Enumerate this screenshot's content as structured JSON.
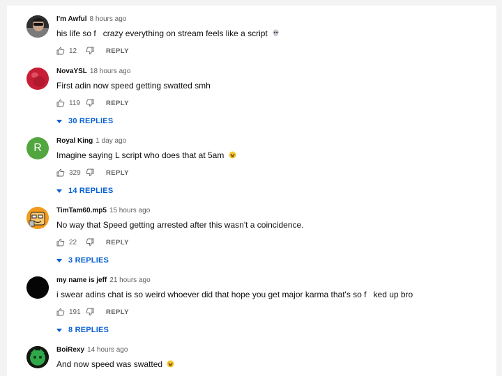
{
  "comments": [
    {
      "author": "I'm Awful",
      "time": "8 hours ago",
      "text_a": "his life so f",
      "text_b": "crazy everything on stream feels like a script",
      "emoji": "skull",
      "likes": "12",
      "reply_label": "REPLY",
      "avatar_icon": "man-with-sunglasses-avatar"
    },
    {
      "author": "NovaYSL",
      "time": "18 hours ago",
      "text": "First adin now speed getting swatted smh",
      "likes": "119",
      "reply_label": "REPLY",
      "replies_label": "30 REPLIES",
      "avatar_icon": "red-apple-avatar"
    },
    {
      "author": "Royal King",
      "time": "1 day ago",
      "text": "Imagine saying L script who does that at 5am",
      "emoji": "laughing-face",
      "likes": "329",
      "reply_label": "REPLY",
      "replies_label": "14 REPLIES",
      "avatar_letter": "R",
      "avatar_color": "#52a63f"
    },
    {
      "author": "TimTam60.mp5",
      "time": "15 hours ago",
      "text": "No way that Speed getting arrested after this wasn't a coincidence.",
      "likes": "22",
      "reply_label": "REPLY",
      "replies_label": "3 REPLIES",
      "avatar_icon": "cartoon-face-avatar"
    },
    {
      "author": "my name is jeff",
      "time": "21 hours ago",
      "text_a": "i swear adins chat is so weird whoever did that hope you get major karma that's so f",
      "text_b": "ked up bro",
      "likes": "191",
      "reply_label": "REPLY",
      "replies_label": "8 REPLIES",
      "avatar_icon": "black-circle-avatar"
    },
    {
      "author": "BoiRexy",
      "time": "14 hours ago",
      "text": "And now speed was swatted",
      "emoji": "laughing-face",
      "avatar_icon": "green-character-avatar"
    }
  ],
  "colors": {
    "link_blue": "#065fd4",
    "royal_avatar": "#52a63f",
    "nova_avatar": "#d8263a"
  }
}
